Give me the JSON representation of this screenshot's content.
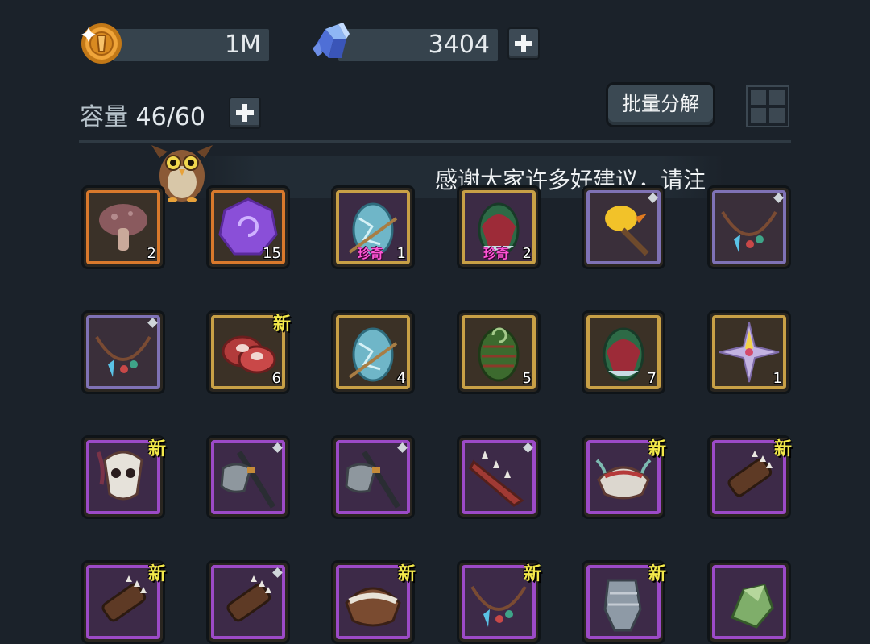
{
  "currency": {
    "gold": {
      "icon": "gold-coin-icon",
      "value": "1M"
    },
    "crystal": {
      "icon": "crystal-icon",
      "value": "3404"
    }
  },
  "inventory": {
    "capacity_label": "容量",
    "capacity_value": "46/60",
    "batch_button": "批量分解",
    "ticker_text": "感谢大家许多好建议，请注"
  },
  "colors": {
    "background": "#1b222a",
    "rarity_gold": "#c8a046",
    "rarity_purple": "#9c4ac7",
    "rarity_orange": "#d9792c",
    "new_tag": "#f2e84a",
    "rare_tag": "#ff56d6"
  },
  "tags": {
    "new": "新",
    "rare": "珍奇"
  },
  "items": [
    {
      "icon": "mushroom-icon",
      "count": "2",
      "rarity": "orange"
    },
    {
      "icon": "purple-rune-stone-icon",
      "count": "15",
      "rarity": "orange"
    },
    {
      "icon": "ice-egg-icon",
      "count": "1",
      "rarity": "gold-purple",
      "rare": true
    },
    {
      "icon": "green-red-egg-icon",
      "count": "2",
      "rarity": "gold-purple",
      "rare": true
    },
    {
      "icon": "duck-axe-icon",
      "count": "",
      "rarity": "lilac",
      "diamond": true
    },
    {
      "icon": "necklace-icon",
      "count": "",
      "rarity": "lilac",
      "diamond": true
    },
    {
      "icon": "necklace-icon",
      "count": "",
      "rarity": "lilac",
      "diamond": true
    },
    {
      "icon": "raw-meat-icon",
      "count": "6",
      "rarity": "gold",
      "new": true
    },
    {
      "icon": "ice-egg-icon",
      "count": "4",
      "rarity": "gold"
    },
    {
      "icon": "pinecone-egg-icon",
      "count": "5",
      "rarity": "gold"
    },
    {
      "icon": "green-red-egg-icon",
      "count": "7",
      "rarity": "gold"
    },
    {
      "icon": "star-crystal-icon",
      "count": "1",
      "rarity": "gold"
    },
    {
      "icon": "skull-mask-icon",
      "count": "",
      "rarity": "purple",
      "new": true
    },
    {
      "icon": "battle-axe-icon",
      "count": "",
      "rarity": "purple",
      "diamond": true
    },
    {
      "icon": "battle-axe-icon",
      "count": "",
      "rarity": "purple",
      "diamond": true
    },
    {
      "icon": "spiked-blade-icon",
      "count": "",
      "rarity": "purple",
      "diamond": true
    },
    {
      "icon": "bone-helmet-icon",
      "count": "",
      "rarity": "purple",
      "new": true
    },
    {
      "icon": "spiked-bracer-icon",
      "count": "",
      "rarity": "purple",
      "new": true
    },
    {
      "icon": "spiked-bracer-icon",
      "count": "",
      "rarity": "purple",
      "new": true
    },
    {
      "icon": "spiked-bracer-icon",
      "count": "",
      "rarity": "purple",
      "diamond": true
    },
    {
      "icon": "fur-helmet-icon",
      "count": "",
      "rarity": "purple",
      "new": true
    },
    {
      "icon": "necklace-icon",
      "count": "",
      "rarity": "purple",
      "new": true
    },
    {
      "icon": "gauntlet-icon",
      "count": "",
      "rarity": "purple",
      "new": true
    },
    {
      "icon": "green-gem-icon",
      "count": "",
      "rarity": "purple"
    }
  ]
}
